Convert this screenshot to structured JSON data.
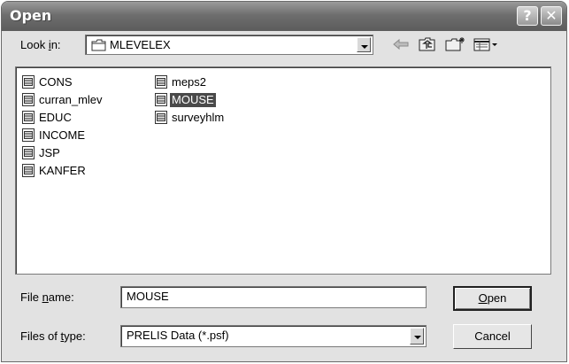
{
  "window": {
    "title": "Open",
    "help_button": "?",
    "close_button": "✕"
  },
  "lookin": {
    "label_pre": "Look ",
    "label_accel": "i",
    "label_post": "n:",
    "value": "MLEVELEX"
  },
  "toolbar": {
    "icons": [
      "back-arrow-icon",
      "up-folder-icon",
      "new-folder-icon",
      "view-menu-icon"
    ]
  },
  "files": {
    "col1": [
      "CONS",
      "curran_mlev",
      "EDUC",
      "INCOME",
      "JSP",
      "KANFER"
    ],
    "col2": [
      "meps2",
      "MOUSE",
      "surveyhlm"
    ],
    "selected": "MOUSE"
  },
  "filename": {
    "label_pre": "File ",
    "label_accel": "n",
    "label_post": "ame:",
    "value": "MOUSE"
  },
  "filetype": {
    "label_pre": "Files of ",
    "label_accel": "t",
    "label_post": "ype:",
    "value": "PRELIS Data (*.psf)"
  },
  "buttons": {
    "open_accel": "O",
    "open_rest": "pen",
    "cancel": "Cancel"
  }
}
